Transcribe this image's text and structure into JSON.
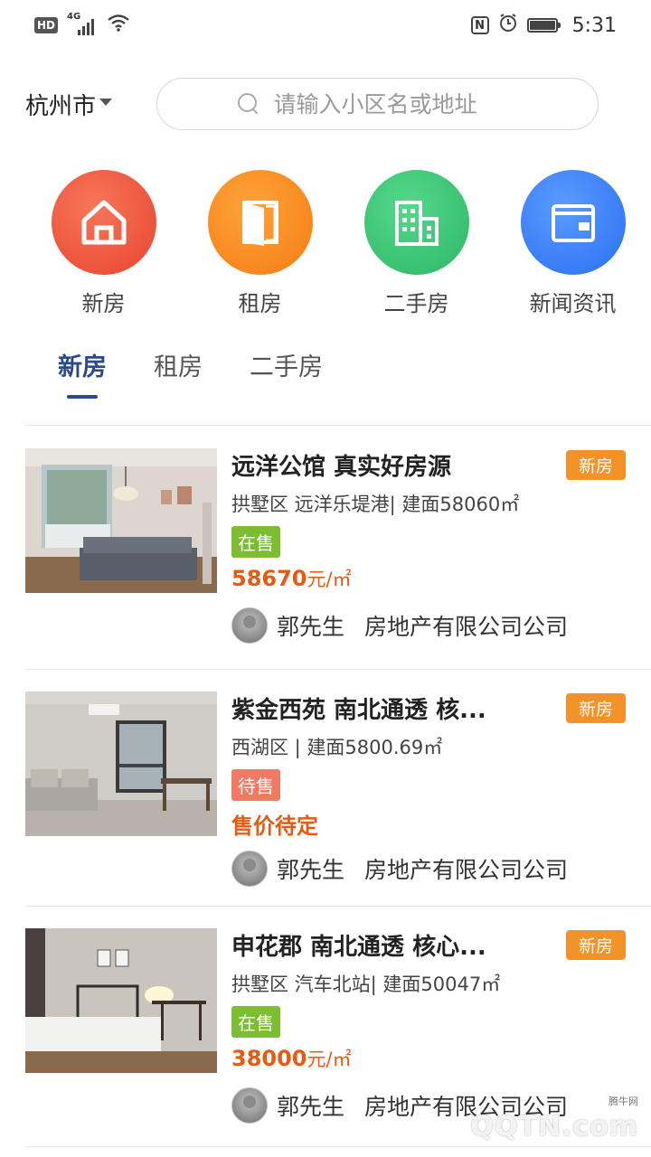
{
  "status_bar": {
    "hd": "HD",
    "network": "4G",
    "nfc": "N",
    "time": "5:31"
  },
  "header": {
    "city": "杭州市",
    "search_placeholder": "请输入小区名或地址"
  },
  "categories": [
    {
      "label": "新房",
      "icon": "house-icon",
      "color": "#ec5236"
    },
    {
      "label": "租房",
      "icon": "door-icon",
      "color": "#f88b22"
    },
    {
      "label": "二手房",
      "icon": "building-icon",
      "color": "#3cc774"
    },
    {
      "label": "新闻资讯",
      "icon": "wallet-icon",
      "color": "#3b7ef6"
    }
  ],
  "tabs": [
    {
      "label": "新房",
      "active": true
    },
    {
      "label": "租房",
      "active": false
    },
    {
      "label": "二手房",
      "active": false
    }
  ],
  "listings": [
    {
      "title": "远洋公馆  真实好房源",
      "tag": "新房",
      "meta": "拱墅区 远洋乐堤港|  建面58060㎡",
      "status": "在售",
      "price": "58670",
      "price_unit": "元/㎡",
      "agent_name": "郭先生",
      "agent_company": "房地产有限公司公司"
    },
    {
      "title": "紫金西苑  南北通透 核...",
      "tag": "新房",
      "meta": "西湖区 |  建面5800.69㎡",
      "status": "待售",
      "price": "售价待定",
      "price_unit": "",
      "agent_name": "郭先生",
      "agent_company": "房地产有限公司公司"
    },
    {
      "title": "申花郡 南北通透 核心...",
      "tag": "新房",
      "meta": "拱墅区 汽车北站|  建面50047㎡",
      "status": "在售",
      "price": "38000",
      "price_unit": "元/㎡",
      "agent_name": "郭先生",
      "agent_company": "房地产有限公司公司"
    }
  ],
  "watermark": {
    "site_label": "腾牛网",
    "brand": "QQTN.com"
  }
}
